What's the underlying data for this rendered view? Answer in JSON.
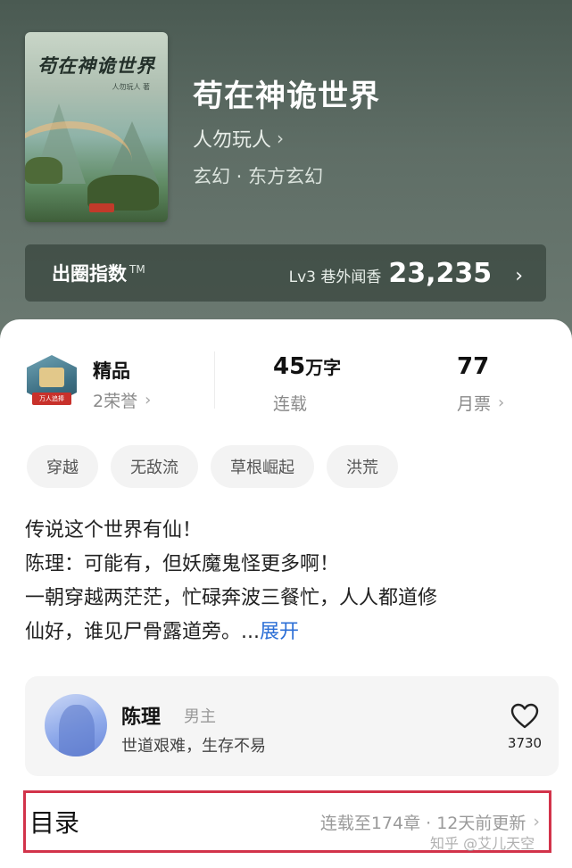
{
  "book": {
    "cover_title": "苟在神诡世界",
    "cover_author": "人勿玩人 著",
    "title": "苟在神诡世界",
    "author": "人勿玩人",
    "genre": "玄幻 · 东方玄幻"
  },
  "index": {
    "label": "出圈指数",
    "tm": "TM",
    "level": "Lv3 巷外闻香",
    "value": "23,235"
  },
  "stats": {
    "quality": {
      "title": "精品",
      "honors": "2荣誉",
      "badge_text": "万人追捧"
    },
    "words": {
      "number": "45",
      "unit": "万字",
      "status": "连载"
    },
    "votes": {
      "number": "77",
      "label": "月票"
    }
  },
  "tags": [
    "穿越",
    "无敌流",
    "草根崛起",
    "洪荒"
  ],
  "synopsis": {
    "lines": [
      "传说这个世界有仙！",
      "陈理：可能有，但妖魔鬼怪更多啊！",
      "一朝穿越两茫茫，忙碌奔波三餐忙，人人都道修",
      "仙好，谁见尸骨露道旁。..."
    ],
    "expand_label": "展开"
  },
  "character": {
    "name": "陈理",
    "role": "男主",
    "desc": "世道艰难，生存不易",
    "likes": "3730"
  },
  "toc": {
    "title": "目录",
    "status": "连载至174章 · 12天前更新"
  },
  "watermark": "知乎 @艾儿天空",
  "colors": {
    "hero_bg": "#5b6a60",
    "link_blue": "#2c6fd6",
    "highlight_border": "#d2334a"
  }
}
